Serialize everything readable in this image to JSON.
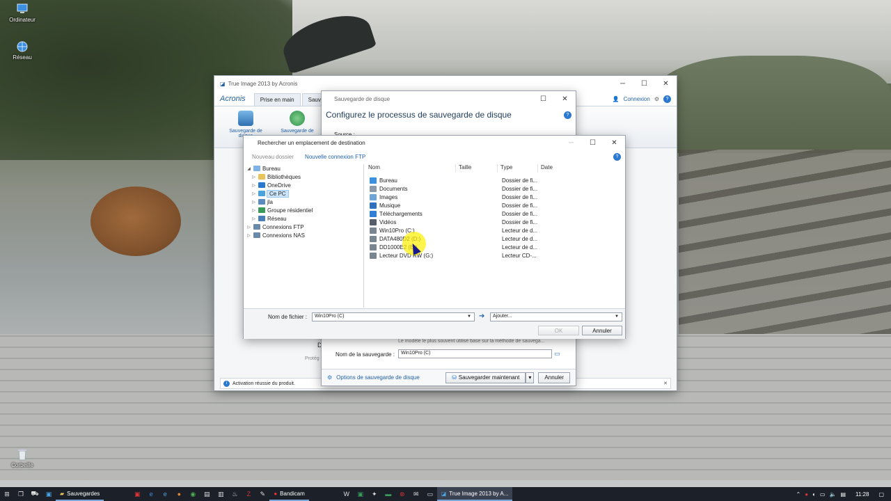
{
  "desktop": {
    "icons": [
      {
        "label": "Ordinateur"
      },
      {
        "label": "Réseau"
      },
      {
        "label": "Corbeille"
      }
    ]
  },
  "acronis": {
    "title": "True Image 2013 by Acronis",
    "logo": "Acronis",
    "tabs": [
      "Prise en main",
      "Sauv"
    ],
    "connexion": "Connexion",
    "tools": [
      "Sauvegarde de disque",
      "Sauvegarde de"
    ],
    "status": "Activation réussie du produit.",
    "behind_text": "Protég",
    "behind_letter": "D"
  },
  "sauvegarde": {
    "title": "Sauvegarde de disque",
    "heading": "Configurez le processus de sauvegarde de disque",
    "source_label": "Source :",
    "method_text": "Le modèle le plus souvent utilisé base sur la méthode de sauvega...",
    "name_label": "Nom de la sauvegarde :",
    "name_value": "Win10Pro (C)",
    "options_link": "Options de sauvegarde de disque",
    "save_now": "Sauvegarder maintenant",
    "cancel": "Annuler"
  },
  "browse": {
    "title": "Rechercher un emplacement de destination",
    "new_folder": "Nouveau dossier",
    "new_ftp": "Nouvelle connexion FTP",
    "tree": [
      {
        "label": "Bureau",
        "level": 0,
        "toggle": "◢",
        "color": "#7fb3e6"
      },
      {
        "label": "Bibliothèques",
        "level": 1,
        "toggle": "▷",
        "color": "#e8c35a"
      },
      {
        "label": "OneDrive",
        "level": 1,
        "toggle": "▷",
        "color": "#2a78d0"
      },
      {
        "label": "Ce PC",
        "level": 1,
        "toggle": "▷",
        "color": "#4aa3df",
        "selected": true
      },
      {
        "label": "jla",
        "level": 1,
        "toggle": "▷",
        "color": "#5b8bbf"
      },
      {
        "label": "Groupe résidentiel",
        "level": 1,
        "toggle": "▷",
        "color": "#3a9a5a"
      },
      {
        "label": "Réseau",
        "level": 1,
        "toggle": "▷",
        "color": "#4a7fb8"
      },
      {
        "label": "Connexions FTP",
        "level": 0,
        "toggle": "▷",
        "color": "#6a8aa8"
      },
      {
        "label": "Connexions NAS",
        "level": 0,
        "toggle": "▷",
        "color": "#6a8aa8"
      }
    ],
    "columns": [
      "Nom",
      "Taille",
      "Type",
      "Date"
    ],
    "items": [
      {
        "name": "Bureau",
        "type": "Dossier de fi...",
        "color": "#3d8fe0"
      },
      {
        "name": "Documents",
        "type": "Dossier de fi...",
        "color": "#8a9aa8"
      },
      {
        "name": "Images",
        "type": "Dossier de fi...",
        "color": "#6fa4d8"
      },
      {
        "name": "Musique",
        "type": "Dossier de fi...",
        "color": "#2f6fc0"
      },
      {
        "name": "Téléchargements",
        "type": "Dossier de fi...",
        "color": "#2f7fd6"
      },
      {
        "name": "Vidéos",
        "type": "Dossier de fi...",
        "color": "#555e6a"
      },
      {
        "name": "Win10Pro (C:)",
        "type": "Lecteur de d...",
        "color": "#7a8590"
      },
      {
        "name": "DATA480D2 (D:)",
        "type": "Lecteur de d...",
        "color": "#7a8590"
      },
      {
        "name": "DD1000E2 (E:)",
        "type": "Lecteur de d...",
        "color": "#7a8590"
      },
      {
        "name": "Lecteur DVD RW (G:)",
        "type": "Lecteur CD-...",
        "color": "#7a8590"
      }
    ],
    "filename_label": "Nom de fichier :",
    "filename_value": "Win10Pro (C)",
    "add_label": "Ajouter...",
    "ok": "OK",
    "cancel": "Annuler"
  },
  "taskbar": {
    "apps": [
      "Sauvegardes",
      "Bandicam",
      "True Image 2013 by A..."
    ],
    "clock": "11:28"
  }
}
